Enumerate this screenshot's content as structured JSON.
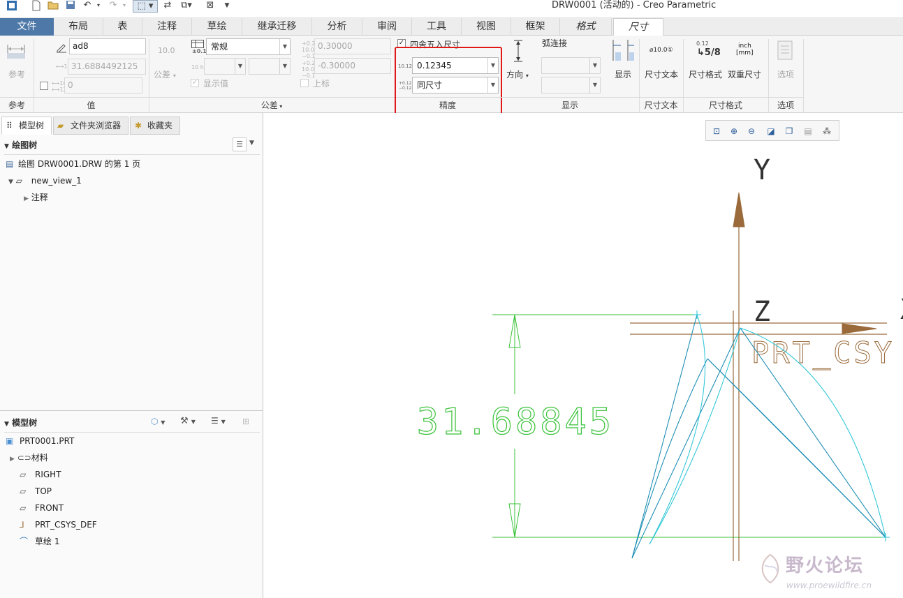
{
  "window": {
    "title": "DRW0001 (活动的) - Creo Parametric"
  },
  "quick_access": {
    "undo_icon": "undo-icon",
    "redo_icon": "redo-icon"
  },
  "tabs": [
    {
      "label": "文件"
    },
    {
      "label": "布局"
    },
    {
      "label": "表"
    },
    {
      "label": "注释"
    },
    {
      "label": "草绘"
    },
    {
      "label": "继承迁移"
    },
    {
      "label": "分析"
    },
    {
      "label": "审阅"
    },
    {
      "label": "工具"
    },
    {
      "label": "视图"
    },
    {
      "label": "框架"
    },
    {
      "label": "格式"
    },
    {
      "label": "尺寸"
    }
  ],
  "ribbon": {
    "reference": {
      "button_label": "参考",
      "footer": "参考"
    },
    "value": {
      "name": "ad8",
      "nominal": "31.6884492125",
      "override": "0",
      "footer": "值"
    },
    "tolerance": {
      "sample": "10.0",
      "button_label": "公差",
      "table_label": "±0.1",
      "table_value": "常规",
      "fit_label": "10 h7",
      "show_value_label": "显示值",
      "upper_value": "0.30000",
      "lower_value": "-0.30000",
      "superscript_label": "上标",
      "footer": "公差"
    },
    "precision": {
      "round_label": "四舍五入尺寸",
      "decimal_icon_text": "10.123",
      "decimal_value": "0.12345",
      "tol_icon_text": "+0.123 −0.123",
      "tol_value": "同尺寸",
      "footer": "精度"
    },
    "display": {
      "direction_label": "方向",
      "arc_label": "弧连接",
      "show_label": "显示",
      "footer": "显示"
    },
    "dim_text": {
      "icon_text": "⌀10.0①",
      "label": "尺寸文本",
      "footer": "尺寸文本"
    },
    "dim_format": {
      "format_icon_top": "0.12",
      "format_icon_bottom": "5/8",
      "format_label": "尺寸格式",
      "dual_icon_top": "inch",
      "dual_icon_bottom": "[mm]",
      "dual_label": "双重尺寸",
      "footer": "尺寸格式"
    },
    "options": {
      "label": "选项",
      "footer": "选项"
    }
  },
  "panel_tabs": [
    {
      "label": "模型树"
    },
    {
      "label": "文件夹浏览器"
    },
    {
      "label": "收藏夹"
    }
  ],
  "drawing_tree": {
    "title": "绘图树",
    "items": [
      {
        "label": "绘图 DRW0001.DRW 的第 1 页"
      },
      {
        "label": "new_view_1"
      },
      {
        "label": "注释"
      }
    ]
  },
  "model_tree": {
    "title": "模型树",
    "items": [
      {
        "label": "PRT0001.PRT"
      },
      {
        "label": "材料"
      },
      {
        "label": "RIGHT"
      },
      {
        "label": "TOP"
      },
      {
        "label": "FRONT"
      },
      {
        "label": "PRT_CSYS_DEF"
      },
      {
        "label": "草绘 1"
      }
    ]
  },
  "drawing": {
    "dimension_value": "31.68845",
    "axis_y": "Y",
    "axis_z": "Z",
    "axis_x": "X",
    "csys_label": "PRT_CSY",
    "dimension_color": "#38c238",
    "csys_color": "#9a6a3a",
    "geometry_color": "#1f8fb5"
  },
  "watermark": {
    "text": "野火论坛",
    "url": "www.proewildfire.cn"
  }
}
